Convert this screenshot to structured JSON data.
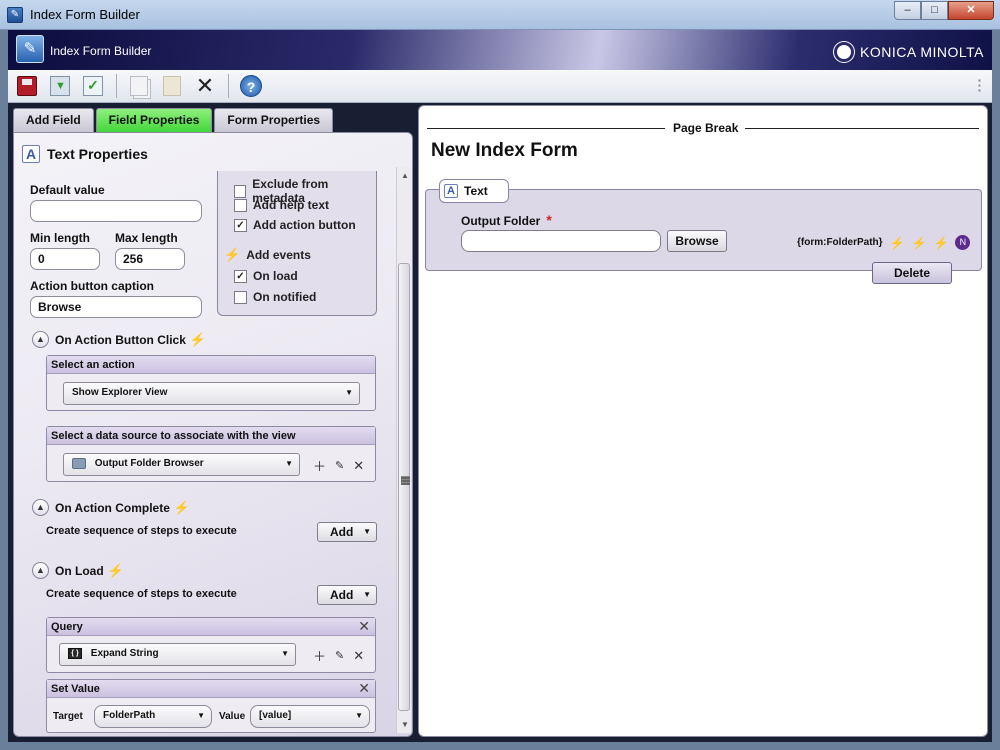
{
  "window": {
    "title": "Index Form Builder",
    "minimize": "‒",
    "maximize": "□",
    "close": "✕"
  },
  "banner": {
    "app_name": "Index Form Builder",
    "brand": "KONICA MINOLTA"
  },
  "toolbar": {
    "save": "save-icon",
    "save_close": "download-icon",
    "validate": "check-icon",
    "copy": "copy-icon",
    "paste": "paste-icon",
    "delete": "✕",
    "help": "?"
  },
  "tabs": [
    {
      "label": "Add Field",
      "active": false
    },
    {
      "label": "Field Properties",
      "active": true
    },
    {
      "label": "Form Properties",
      "active": false
    }
  ],
  "props": {
    "title": "Text Properties",
    "default_value_label": "Default value",
    "default_value": "",
    "min_length_label": "Min length",
    "min_length": "0",
    "max_length_label": "Max length",
    "max_length": "256",
    "action_caption_label": "Action button caption",
    "action_caption": "Browse",
    "options": [
      {
        "label": "Exclude from metadata",
        "checked": false
      },
      {
        "label": "Add help text",
        "checked": false
      },
      {
        "label": "Add action button",
        "checked": true
      }
    ],
    "events_label": "Add events",
    "events": [
      {
        "label": "On load",
        "checked": true
      },
      {
        "label": "On notified",
        "checked": false
      }
    ]
  },
  "on_action_click": {
    "title": "On Action Button Click",
    "select_action_label": "Select an action",
    "action": "Show Explorer View",
    "datasource_label": "Select a data source to associate with the view",
    "datasource": "Output Folder Browser"
  },
  "on_action_complete": {
    "title": "On Action Complete",
    "seq_text": "Create sequence of steps to execute",
    "add_label": "Add"
  },
  "on_load": {
    "title": "On Load",
    "seq_text": "Create sequence of steps to execute",
    "add_label": "Add",
    "query_label": "Query",
    "query_value": "Expand String",
    "setvalue_label": "Set Value",
    "target_label": "Target",
    "target_value": "FolderPath",
    "value_label": "Value",
    "value_value": "[value]"
  },
  "form": {
    "page_break": "Page Break",
    "title": "New Index Form",
    "field_type": "Text",
    "field_label": "Output Folder",
    "required_mark": "*",
    "browse_label": "Browse",
    "binding": "{form:FolderPath}",
    "badge": "N",
    "delete_label": "Delete"
  },
  "colors": {
    "active_tab": "#42d63a",
    "brand_dark": "#0c0c3e",
    "required": "#d92020",
    "event_bolt": "#e0a11e"
  }
}
